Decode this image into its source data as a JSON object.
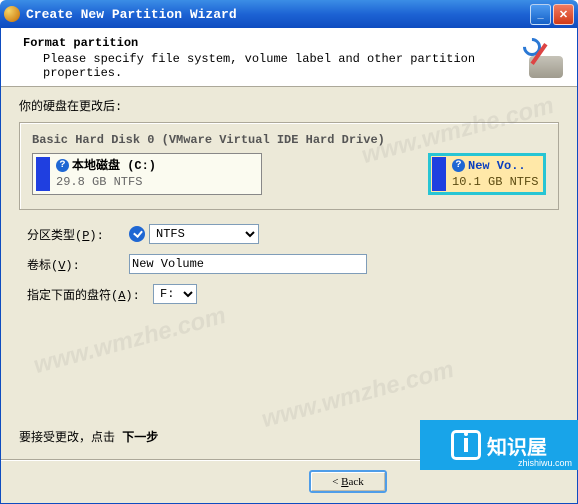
{
  "window": {
    "title": "Create New Partition Wizard"
  },
  "header": {
    "title": "Format partition",
    "subtitle": "Please specify file system, volume label and other partition properties."
  },
  "body": {
    "intro": "你的硬盘在更改后:",
    "disk": {
      "title": "Basic Hard Disk 0 (VMware Virtual IDE Hard Drive)",
      "partitions": [
        {
          "name": "本地磁盘 (C:)",
          "detail": "29.8 GB NTFS",
          "selected": false
        },
        {
          "name": "New Vo..",
          "detail": "10.1 GB NTFS",
          "selected": true
        }
      ]
    },
    "form": {
      "type_label": "分区类型",
      "type_key": "P",
      "type_options": [
        "NTFS"
      ],
      "type_value": "NTFS",
      "label_label": "卷标",
      "label_key": "V",
      "label_value": "New Volume",
      "letter_label": "指定下面的盘符",
      "letter_key": "A",
      "letter_options": [
        "F:"
      ],
      "letter_value": "F:"
    },
    "note_prefix": "要接受更改，点击 ",
    "note_bold": "下一步"
  },
  "buttons": {
    "back": "Back",
    "back_key": "B"
  },
  "promo": {
    "brand": "知识屋",
    "url": "zhishiwu.com"
  },
  "watermark": "www.wmzhe.com"
}
